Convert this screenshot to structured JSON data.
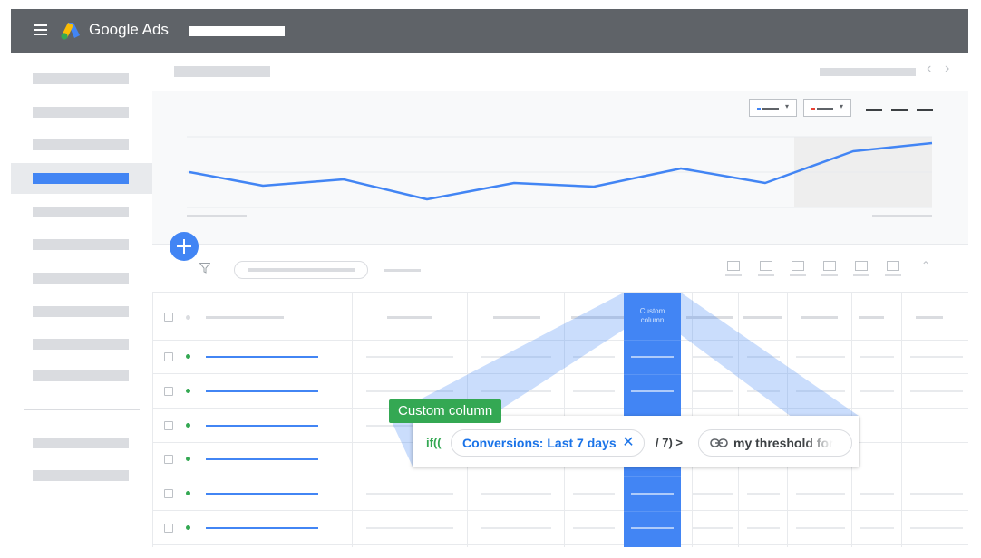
{
  "app": {
    "brand": "Google Ads",
    "brand_colors": {
      "blue": "#4285f4",
      "green": "#34a853",
      "yellow": "#fbbc04",
      "red": "#ea4335",
      "topbar": "#5f6368"
    }
  },
  "icons": [
    "menu-icon",
    "google-ads-logo-icon",
    "chevron-left-icon",
    "chevron-right-icon",
    "add-icon",
    "filter-icon",
    "collapse-icon",
    "close-icon",
    "link-icon"
  ],
  "table": {
    "custom_column_header": "Custom column",
    "row_status": "enabled",
    "row_status_color": "#34a853"
  },
  "formula": {
    "tag": "Custom column",
    "prefix": "if((",
    "metric_chip": "Conversions: Last 7 days",
    "operator": "/ 7) >",
    "variable_chip": "my threshold for"
  }
}
